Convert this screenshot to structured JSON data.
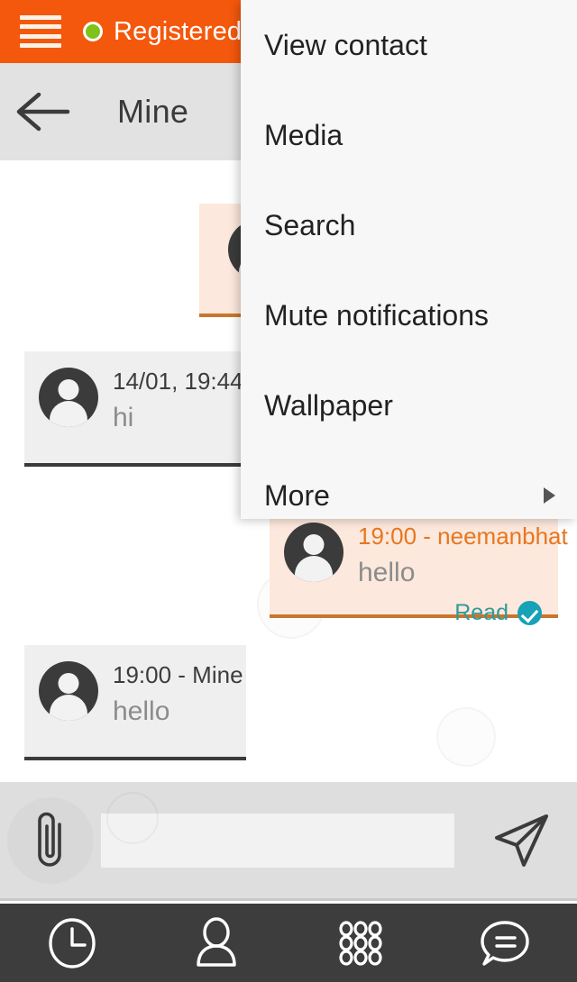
{
  "statusbar": {
    "menu_icon": "hamburger-icon",
    "registration_status": "Registered",
    "status_dot_color": "#7ec21b",
    "background_color": "#f4580c"
  },
  "toolbar": {
    "back_icon": "back-arrow-icon",
    "title": "Mine",
    "background_color": "#e2e2e2"
  },
  "overflow_menu": {
    "visible": true,
    "background_color": "#f7f7f7",
    "items": [
      {
        "label": "View contact",
        "has_submenu": false
      },
      {
        "label": "Media",
        "has_submenu": false
      },
      {
        "label": "Search",
        "has_submenu": false
      },
      {
        "label": "Mute notifications",
        "has_submenu": false
      },
      {
        "label": "Wallpaper",
        "has_submenu": false
      },
      {
        "label": "More",
        "has_submenu": true
      }
    ]
  },
  "messages": [
    {
      "direction": "outgoing",
      "meta": "",
      "text": "",
      "read_label": "",
      "avatar": "person-avatar",
      "occluded": true
    },
    {
      "direction": "incoming",
      "meta": "14/01, 19:44 -",
      "text": "hi",
      "read_label": "",
      "avatar": "person-avatar",
      "occluded": false
    },
    {
      "direction": "outgoing",
      "meta": "19:00 - neemanbhat",
      "text": "hello",
      "read_label": "Read",
      "avatar": "person-avatar",
      "occluded": false
    },
    {
      "direction": "incoming",
      "meta": "19:00 - Mine",
      "text": "hello",
      "read_label": "",
      "avatar": "person-avatar",
      "occluded": false
    }
  ],
  "colors": {
    "accent_orange": "#f4580c",
    "outgoing_bubble": "#fce8dc",
    "outgoing_border": "#c8762c",
    "incoming_bubble": "#efefef",
    "incoming_border": "#3a3a3a",
    "read_teal": "#2f9a9a",
    "read_tick": "#17a2b8"
  },
  "composer": {
    "attach_icon": "paperclip-icon",
    "input_value": "",
    "input_placeholder": "",
    "send_icon": "send-icon"
  },
  "bottom_nav": {
    "background_color": "#3d3d3d",
    "items": [
      {
        "icon": "clock-icon",
        "label": ""
      },
      {
        "icon": "person-icon",
        "label": ""
      },
      {
        "icon": "dialpad-icon",
        "label": ""
      },
      {
        "icon": "chat-bubble-icon",
        "label": ""
      }
    ]
  }
}
